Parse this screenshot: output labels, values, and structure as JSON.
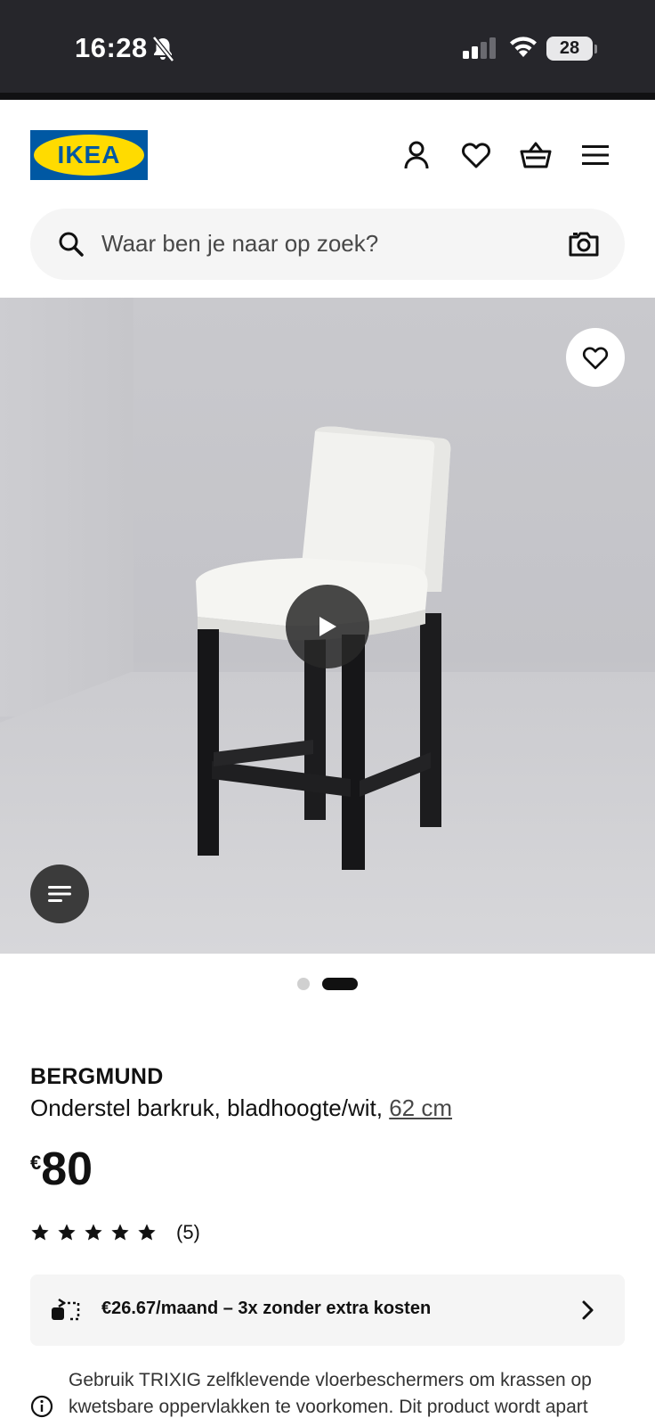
{
  "status_bar": {
    "time": "16:28",
    "battery": "28"
  },
  "header": {
    "logo_text": "IKEA",
    "search_placeholder": "Waar ben je naar op zoek?"
  },
  "product": {
    "name": "BERGMUND",
    "description": "Onderstel barkruk, bladhoogte/wit, ",
    "size": "62 cm",
    "price_currency": "€",
    "price_value": "80",
    "rating_stars": 5,
    "rating_count": "(5)"
  },
  "carousel": {
    "total_images": 2,
    "active_index": 1
  },
  "financing": {
    "text": "€26.67/maand – 3x zonder extra kosten"
  },
  "notice": {
    "text": "Gebruik TRIXIG zelfklevende vloerbeschermers om krassen op kwetsbare oppervlakken te voorkomen. Dit product wordt apart"
  },
  "colors": {
    "brand_blue": "#0058a3",
    "brand_yellow": "#ffdb00",
    "status_bar_bg": "#26262b"
  }
}
